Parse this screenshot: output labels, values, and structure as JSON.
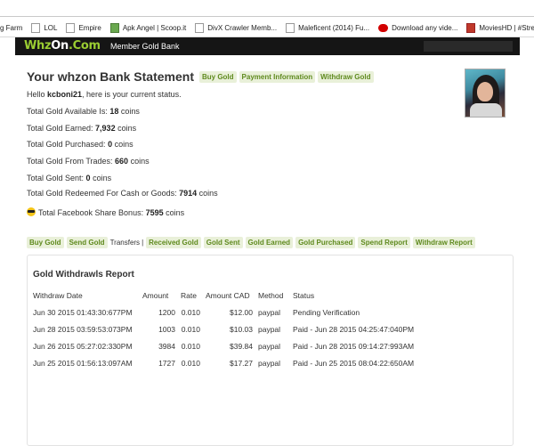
{
  "bookmarks": [
    {
      "label": "g Farm",
      "icon": "none"
    },
    {
      "label": "LOL",
      "icon": "page-icon"
    },
    {
      "label": "Empire",
      "icon": "page-icon"
    },
    {
      "label": "Apk Angel | Scoop.it",
      "icon": "scoopit-icon"
    },
    {
      "label": "DivX Crawler Memb...",
      "icon": "page-icon"
    },
    {
      "label": "Maleficent (2014) Fu...",
      "icon": "page-icon"
    },
    {
      "label": "Download any vide...",
      "icon": "youtube-icon"
    },
    {
      "label": "MoviesHD | #Strea...",
      "icon": "movieshd-icon"
    }
  ],
  "header": {
    "logo_whz": "Whz",
    "logo_on": "On",
    "logo_com": ".Com",
    "title": "Member Gold Bank"
  },
  "statement": {
    "title": "Your whzon Bank Statement",
    "tags": [
      "Buy Gold",
      "Payment Information",
      "Withdraw Gold"
    ],
    "greeting_prefix": "Hello ",
    "username": "kcboni21",
    "greeting_suffix": ", here is your current status.",
    "stats": [
      {
        "label": "Total Gold Available Is: ",
        "value": "18",
        "unit": " coins"
      },
      {
        "label": "Total Gold Earned: ",
        "value": "7,932",
        "unit": " coins"
      },
      {
        "label": "Total Gold Purchased: ",
        "value": "0",
        "unit": " coins"
      },
      {
        "label": "Total Gold From Trades: ",
        "value": "660",
        "unit": " coins"
      },
      {
        "label": "Total Gold Sent: ",
        "value": "0",
        "unit": " coins"
      },
      {
        "label": "Total Gold Redeemed For Cash or Goods: ",
        "value": "7914",
        "unit": " coins"
      },
      {
        "label": "Total Facebook Share Bonus: ",
        "value": "7595",
        "unit": " coins"
      }
    ]
  },
  "subnav": {
    "links_left": [
      "Buy Gold",
      "Send Gold"
    ],
    "current": "Transfers",
    "separator": "|",
    "links_right": [
      "Received Gold",
      "Gold Sent",
      "Gold Earned",
      "Gold Purchased",
      "Spend Report",
      "Withdraw Report"
    ]
  },
  "report": {
    "title": "Gold Withdrawls Report",
    "columns": [
      "Withdraw Date",
      "Amount",
      "Rate",
      "Amount CAD",
      "Method",
      "Status"
    ],
    "rows": [
      [
        "Jun 30 2015 01:43:30:677PM",
        "1200",
        "0.010",
        "$12.00",
        "paypal",
        "Pending Verification"
      ],
      [
        "Jun 28 2015 03:59:53:073PM",
        "1003",
        "0.010",
        "$10.03",
        "paypal",
        "Paid - Jun 28 2015 04:25:47:040PM"
      ],
      [
        "Jun 26 2015 05:27:02:330PM",
        "3984",
        "0.010",
        "$39.84",
        "paypal",
        "Paid - Jun 28 2015 09:14:27:993AM"
      ],
      [
        "Jun 25 2015 01:56:13:097AM",
        "1727",
        "0.010",
        "$17.27",
        "paypal",
        "Paid - Jun 25 2015 08:04:22:650AM"
      ]
    ]
  },
  "colors": {
    "header_bg": "#151515",
    "logo_green": "#9acd32",
    "tag_bg": "#e9f0d9",
    "tag_text": "#5f8a1e"
  }
}
